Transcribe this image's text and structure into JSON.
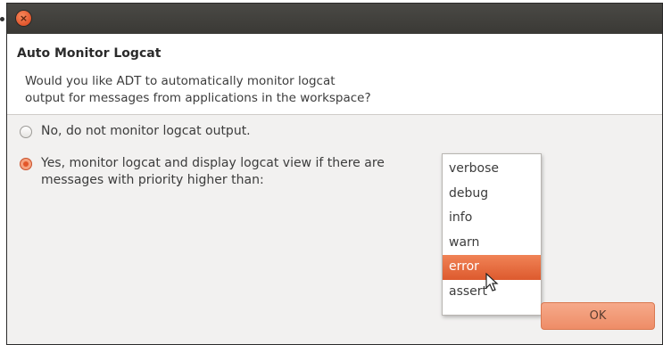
{
  "dialog": {
    "header_title": "Auto Monitor Logcat",
    "description_line1": "Would you like ADT to automatically monitor logcat",
    "description_line2": "output for messages from applications in the workspace?"
  },
  "options": {
    "no_label": "No, do not monitor logcat output.",
    "yes_label_line1": "Yes, monitor logcat and display logcat view if there are",
    "yes_label_line2": "messages with priority higher than:",
    "selected": "yes"
  },
  "priority_dropdown": {
    "items": [
      "verbose",
      "debug",
      "info",
      "warn",
      "error",
      "assert"
    ],
    "highlighted": "error"
  },
  "buttons": {
    "ok_label": "OK"
  },
  "colors": {
    "accent": "#e3572a",
    "titlebar": "#3c3b37"
  }
}
